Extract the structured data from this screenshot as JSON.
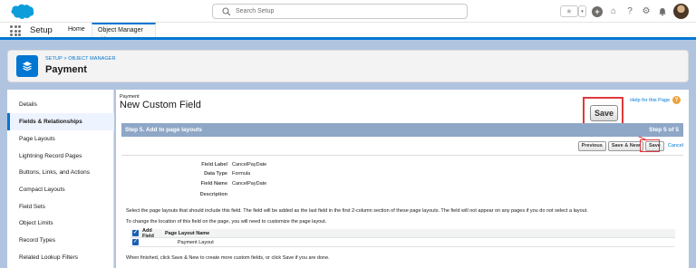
{
  "header": {
    "search_placeholder": "Search Setup",
    "favorite_star": "★",
    "dropdown_caret": "▾",
    "help_glyph": "?",
    "settings_glyph": "⚙",
    "notifications_glyph": "🔔",
    "add_glyph": "+",
    "trailhead_glyph": "⌂"
  },
  "nav": {
    "app_name": "Setup",
    "tabs": [
      {
        "label": "Home"
      },
      {
        "label": "Object Manager"
      }
    ],
    "chevron": "⌵"
  },
  "object_header": {
    "breadcrumb": "SETUP > OBJECT MANAGER",
    "title": "Payment"
  },
  "sidebar": {
    "items": [
      {
        "label": "Details"
      },
      {
        "label": "Fields & Relationships"
      },
      {
        "label": "Page Layouts"
      },
      {
        "label": "Lightning Record Pages"
      },
      {
        "label": "Buttons, Links, and Actions"
      },
      {
        "label": "Compact Layouts"
      },
      {
        "label": "Field Sets"
      },
      {
        "label": "Object Limits"
      },
      {
        "label": "Record Types"
      },
      {
        "label": "Related Lookup Filters"
      }
    ],
    "active_index": 1
  },
  "main": {
    "breadcrumb": "Payment",
    "title": "New Custom Field",
    "help_link": "Help for this Page",
    "help_glyph": "?",
    "zoom_save_label": "Save",
    "step_title": "Step 5. Add to page layouts",
    "step_count": "Step 5 of 5",
    "buttons": {
      "previous": "Previous",
      "save_new": "Save & New",
      "save": "Save",
      "cancel": "Cancel"
    },
    "fields": [
      {
        "label": "Field Label",
        "value": "CancelPayDate"
      },
      {
        "label": "Data Type",
        "value": "Formula"
      },
      {
        "label": "Field Name",
        "value": "CancelPayDate"
      },
      {
        "label": "Description",
        "value": ""
      }
    ],
    "instruction1": "Select the page layouts that should include this field. The field will be added as the last field in the first 2-column section of these page layouts. The field will not appear on any pages if you do not select a layout.",
    "instruction2": "To change the location of this field on the page, you will need to customize the page layout.",
    "table": {
      "header_add": "Add Field",
      "header_name": "Page Layout Name",
      "rows": [
        {
          "checked": true,
          "name": "Payment Layout"
        }
      ]
    },
    "checkbox_glyph": "✓",
    "footer_note": "When finished, click Save & New to create more custom fields, or click Save if you are done."
  },
  "colors": {
    "brand": "#0176d3",
    "step_bar": "#8fa7c7",
    "highlight": "#e0383b",
    "page_bg": "#b0c4df"
  }
}
